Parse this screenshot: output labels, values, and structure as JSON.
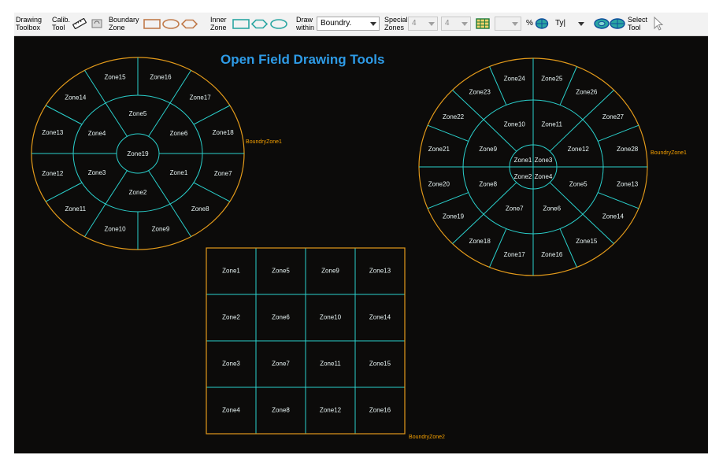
{
  "toolbar": {
    "drawing_toolbox": "Drawing\nToolbox",
    "calib_tool": "Calib.\nTool",
    "boundary_zone": "Boundary\nZone",
    "inner_zone": "Inner\nZone",
    "draw_within": "Draw\nwithin",
    "draw_within_value": "Boundry.",
    "special_zones": "Special\nZones",
    "special_rows": "4",
    "special_cols": "4",
    "percent": "%",
    "type_value": "Ty|",
    "select_tool": "Select\nTool"
  },
  "canvas": {
    "title": "Open Field Drawing Tools",
    "background": "#0c0b0a",
    "zone_line_color": "#2ad0cc",
    "boundary_color": "#e39a1a",
    "circle1": {
      "boundary_label": "BoundryZone1",
      "center_label": "Zone19",
      "inner_labels": [
        "Zone1",
        "Zone2",
        "Zone3",
        "Zone4",
        "Zone5",
        "Zone6"
      ],
      "outer_labels": [
        "Zone7",
        "Zone8",
        "Zone9",
        "Zone10",
        "Zone11",
        "Zone12",
        "Zone13",
        "Zone14",
        "Zone15",
        "Zone16",
        "Zone17",
        "Zone18"
      ]
    },
    "circle2": {
      "boundary_label": "BoundryZone1",
      "center_labels": [
        "Zone1",
        "Zone2",
        "Zone3",
        "Zone4"
      ],
      "inner_labels": [
        "Zone5",
        "Zone6",
        "Zone7",
        "Zone8",
        "Zone9",
        "Zone10",
        "Zone11",
        "Zone12"
      ],
      "outer_labels": [
        "Zone13",
        "Zone14",
        "Zone15",
        "Zone16",
        "Zone17",
        "Zone18",
        "Zone19",
        "Zone20",
        "Zone21",
        "Zone22",
        "Zone23",
        "Zone24",
        "Zone25",
        "Zone26",
        "Zone27",
        "Zone28"
      ]
    },
    "grid": {
      "boundary_label": "BoundryZone2",
      "rows": [
        [
          "Zone1",
          "Zone5",
          "Zone9",
          "Zone13"
        ],
        [
          "Zone2",
          "Zone6",
          "Zone10",
          "Zone14"
        ],
        [
          "Zone3",
          "Zone7",
          "Zone11",
          "Zone15"
        ],
        [
          "Zone4",
          "Zone8",
          "Zone12",
          "Zone16"
        ]
      ]
    }
  }
}
